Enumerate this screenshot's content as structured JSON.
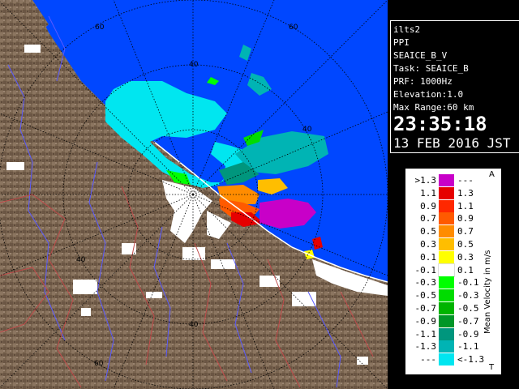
{
  "info": {
    "radar_name": "ilts2",
    "scan_type": "PPI",
    "product": "SEAICE_B_V",
    "task": "Task: SEAICE_B",
    "prf": "PRF: 1000Hz",
    "elevation": "Elevation:1.0",
    "max_range": "Max Range:60 km",
    "time": "23:35:18",
    "date": "13 FEB 2016 JST"
  },
  "range_rings": {
    "labels": [
      "60",
      "40",
      "40",
      "40",
      "40",
      "60",
      "60"
    ]
  },
  "legend": {
    "title": "Mean Velocity in m/s",
    "rows": [
      {
        "left": ">1.3",
        "right": "---",
        "color": "#c800c8"
      },
      {
        "left": "1.1",
        "right": "1.3",
        "color": "#e60000"
      },
      {
        "left": "0.9",
        "right": "1.1",
        "color": "#ff2800"
      },
      {
        "left": "0.7",
        "right": "0.9",
        "color": "#ff5a00"
      },
      {
        "left": "0.5",
        "right": "0.7",
        "color": "#ff8c00"
      },
      {
        "left": "0.3",
        "right": "0.5",
        "color": "#ffbe00"
      },
      {
        "left": "0.1",
        "right": "0.3",
        "color": "#ffff00"
      },
      {
        "left": "-0.1",
        "right": "0.1",
        "color": "#ffffff"
      },
      {
        "left": "-0.3",
        "right": "-0.1",
        "color": "#00ff00"
      },
      {
        "left": "-0.5",
        "right": "-0.3",
        "color": "#00dc00"
      },
      {
        "left": "-0.7",
        "right": "-0.5",
        "color": "#00b400"
      },
      {
        "left": "-0.9",
        "right": "-0.7",
        "color": "#009628"
      },
      {
        "left": "-1.1",
        "right": "-0.9",
        "color": "#00967d"
      },
      {
        "left": "-1.3",
        "right": "-1.1",
        "color": "#00b4b4"
      },
      {
        "left": "---",
        "right": "<-1.3",
        "color": "#00e6f0"
      }
    ]
  },
  "colors": {
    "sea": "#0047ff",
    "land": "#7a6550",
    "coast_highlight": "#ffffff",
    "grid": "#000000",
    "rivers": "#5a5aff",
    "roads": "#c04a4a"
  }
}
